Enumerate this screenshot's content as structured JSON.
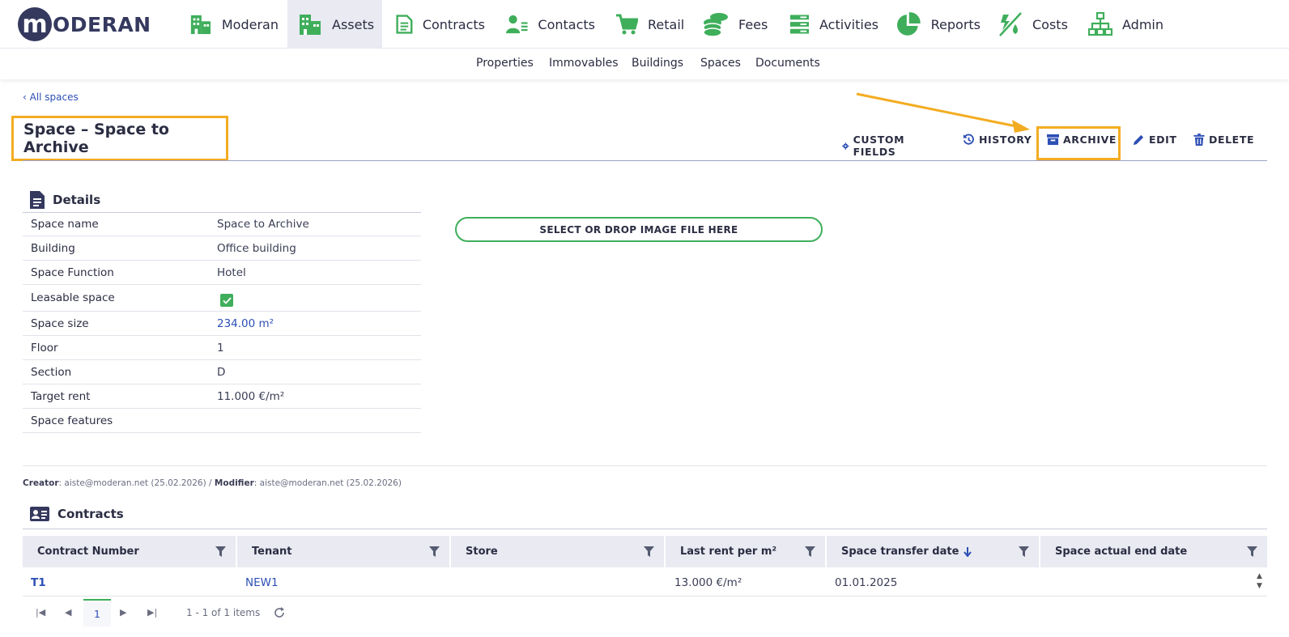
{
  "app": {
    "logo_letter": "m",
    "logo_text": "ODERAN"
  },
  "topnav": {
    "items": [
      {
        "label": "Moderan",
        "icon": "building-icon"
      },
      {
        "label": "Assets",
        "icon": "building-icon",
        "active": true
      },
      {
        "label": "Contracts",
        "icon": "document-icon"
      },
      {
        "label": "Contacts",
        "icon": "contact-icon"
      },
      {
        "label": "Retail",
        "icon": "cart-icon"
      },
      {
        "label": "Fees",
        "icon": "coins-icon"
      },
      {
        "label": "Activities",
        "icon": "list-icon"
      },
      {
        "label": "Reports",
        "icon": "pie-chart-icon"
      },
      {
        "label": "Costs",
        "icon": "utility-icon"
      },
      {
        "label": "Admin",
        "icon": "sitemap-icon"
      }
    ]
  },
  "subnav": {
    "items": [
      "Properties",
      "Immovables",
      "Buildings",
      "Spaces",
      "Documents"
    ]
  },
  "breadcrumb": "‹ All spaces",
  "page_title": "Space – Space to Archive",
  "actions": {
    "custom_fields": "CUSTOM FIELDS",
    "history": "HISTORY",
    "archive": "ARCHIVE",
    "edit": "EDIT",
    "delete": "DELETE"
  },
  "details": {
    "heading": "Details",
    "rows": [
      {
        "label": "Space name",
        "value": "Space to Archive"
      },
      {
        "label": "Building",
        "value": "Office building"
      },
      {
        "label": "Space Function",
        "value": "Hotel"
      },
      {
        "label": "Leasable space",
        "value": "",
        "checked": true
      },
      {
        "label": "Space size",
        "value": "234.00 m²"
      },
      {
        "label": "Floor",
        "value": "1"
      },
      {
        "label": "Section",
        "value": "D"
      },
      {
        "label": "Target rent",
        "value": "11.000 €/m²"
      },
      {
        "label": "Space features",
        "value": ""
      }
    ]
  },
  "image_drop": "SELECT OR DROP IMAGE FILE HERE",
  "meta": {
    "creator_label": "Creator",
    "creator_value": ": aiste@moderan.net (25.02.2026) / ",
    "modifier_label": "Modifier",
    "modifier_value": ": aiste@moderan.net (25.02.2026)"
  },
  "contracts": {
    "heading": "Contracts",
    "columns": [
      "Contract Number",
      "Tenant",
      "Store",
      "Last rent per m²",
      "Space transfer date",
      "Space actual end date"
    ],
    "rows": [
      [
        "T1",
        "NEW1",
        "",
        "13.000 €/m²",
        "01.01.2025",
        ""
      ]
    ],
    "pager": {
      "current_page": "1",
      "info": "1 - 1 of 1 items"
    }
  },
  "colors": {
    "accent_green": "#3fae5b",
    "highlight_orange": "#f3ac21",
    "link_blue": "#2d4fb5",
    "navy": "#35395e"
  }
}
